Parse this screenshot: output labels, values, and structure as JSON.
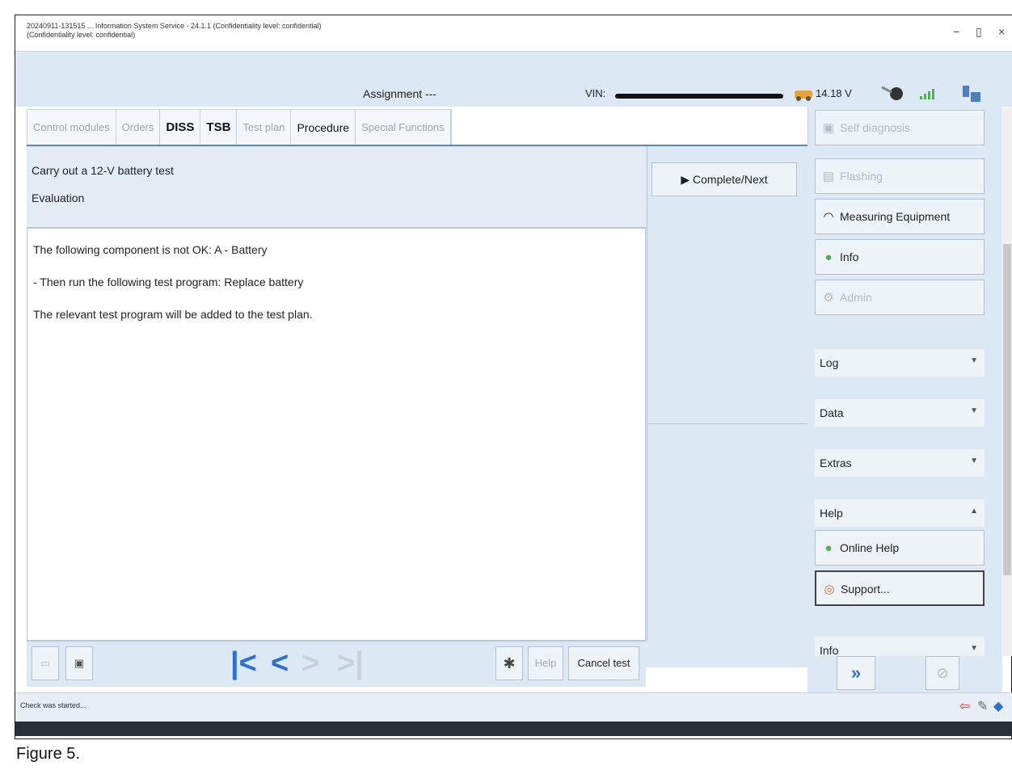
{
  "window": {
    "title_line1": "20240911-131515 ... Information System Service - 24.1.1 (Confidentiality level: confidential)",
    "title_line2": "(Confidentiality level: confidential)",
    "minimize": "−",
    "restore": "▯",
    "close": "×"
  },
  "header": {
    "assignment": "Assignment ---",
    "vin_label": "VIN:",
    "voltage": "14.18 V"
  },
  "tabs": [
    {
      "label": "Control modules"
    },
    {
      "label": "Orders"
    },
    {
      "label": "DISS"
    },
    {
      "label": "TSB"
    },
    {
      "label": "Test plan"
    },
    {
      "label": "Procedure"
    },
    {
      "label": "Special Functions"
    }
  ],
  "procedure": {
    "title": "Carry out a 12-V battery test",
    "subtitle": "Evaluation",
    "lines": [
      "The following component is not OK: A - Battery",
      "- Then run the following test program: Replace battery",
      "The relevant test program will be added to the test plan."
    ],
    "complete_next": "Complete/Next"
  },
  "toolbar": {
    "help": "Help",
    "cancel": "Cancel test"
  },
  "sidebar": {
    "self_diagnosis": "Self diagnosis",
    "flashing": "Flashing",
    "measuring": "Measuring Equipment",
    "info": "Info",
    "admin": "Admin",
    "log": "Log",
    "data": "Data",
    "extras": "Extras",
    "help": "Help",
    "online_help": "Online Help",
    "support": "Support...",
    "info2": "Info"
  },
  "status": {
    "text": "Check was started..."
  },
  "caption": "Figure 5."
}
